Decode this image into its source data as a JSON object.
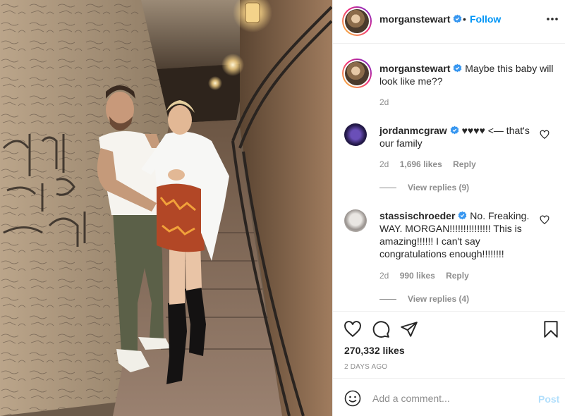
{
  "post": {
    "author": "morganstewart",
    "follow_label": "Follow",
    "dot": "•",
    "more_icon": "more-horizontal-icon",
    "photo_alt": "Couple in a graffiti-covered tunnel"
  },
  "caption": {
    "username": "morganstewart",
    "text": "Maybe this baby will look like me??",
    "time": "2d"
  },
  "comments": [
    {
      "username": "jordanmcgraw",
      "verified": true,
      "text": "♥♥♥♥ <— that's our family",
      "time": "2d",
      "likes": "1,696 likes",
      "reply_label": "Reply",
      "view_replies": "View replies (9)"
    },
    {
      "username": "stassischroeder",
      "verified": true,
      "text": "No. Freaking. WAY. MORGAN!!!!!!!!!!!!!!! This is amazing!!!!!! I can't say congratulations enough!!!!!!!!",
      "time": "2d",
      "likes": "990 likes",
      "reply_label": "Reply",
      "view_replies": "View replies (4)"
    }
  ],
  "actions": {
    "likes": "270,332 likes",
    "ago": "2 DAYS AGO",
    "icons": [
      "heart-icon",
      "comment-icon",
      "share-icon",
      "bookmark-icon"
    ]
  },
  "add_comment": {
    "placeholder": "Add a comment...",
    "post_label": "Post"
  },
  "colors": {
    "accent": "#0095f6",
    "post_disabled": "#b2dffc",
    "muted": "#8e8e8e",
    "verified": "#3897f0"
  }
}
